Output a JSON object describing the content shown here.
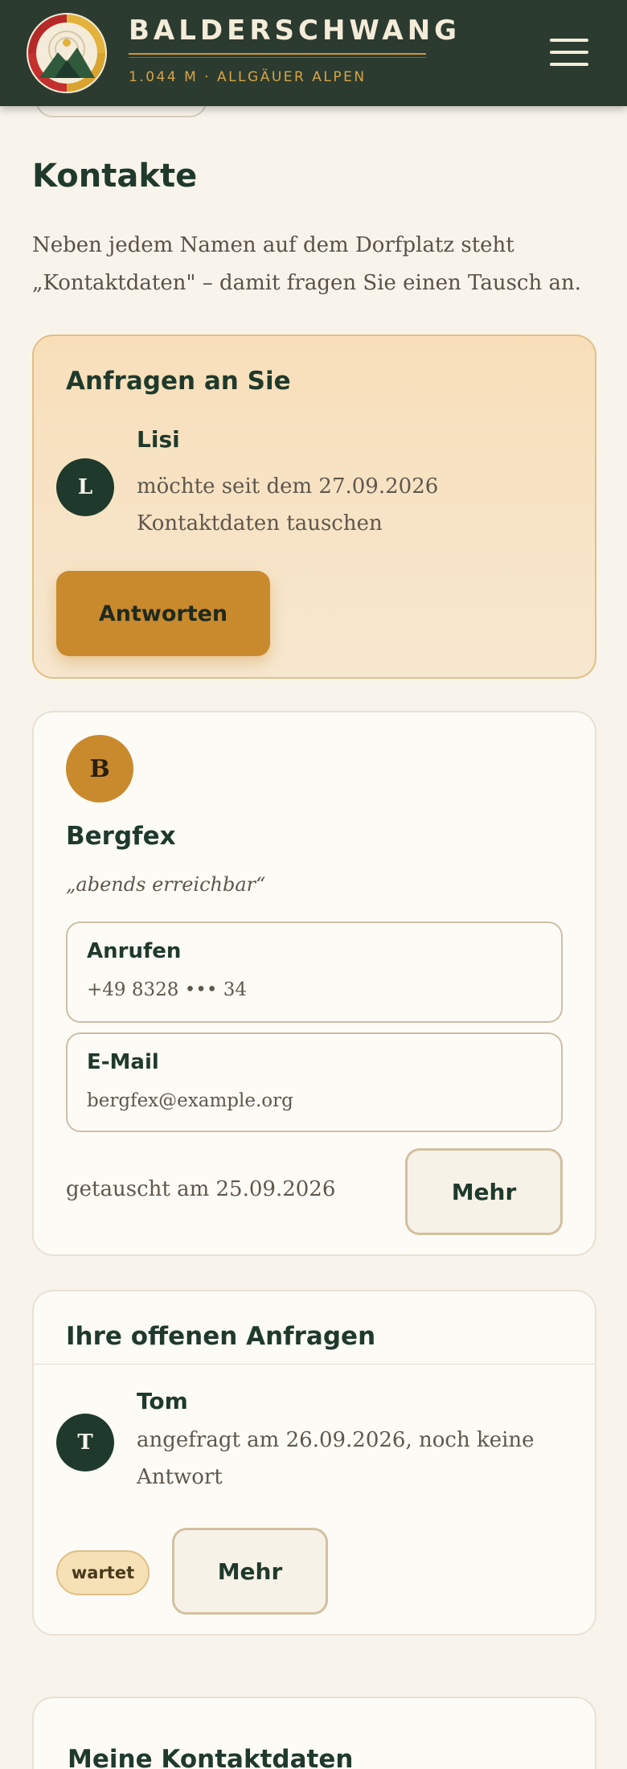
{
  "header": {
    "title": "BALDERSCHWANG",
    "subtitle": "1.044 M · ALLGÄUER ALPEN",
    "menu_icon": "hamburger-menu-icon"
  },
  "page": {
    "title": "Kontakte",
    "intro": "Neben jedem Namen auf dem Dorfplatz steht „Kontaktdaten\" – damit fragen Sie einen Tausch an."
  },
  "incoming": {
    "heading": "Anfragen an Sie",
    "request": {
      "initial": "L",
      "name": "Lisi",
      "text": "möchte seit dem 27.09.2026 Kontaktdaten tauschen"
    },
    "answer_label": "Antworten"
  },
  "contact": {
    "initial": "B",
    "name": "Bergfex",
    "note": "„abends erreichbar“",
    "call_label": "Anrufen",
    "call_value": "+49 8328 ••• 34",
    "email_label": "E-Mail",
    "email_value": "bergfex@example.org",
    "exchanged": "getauscht am 25.09.2026",
    "more_label": "Mehr"
  },
  "outgoing": {
    "heading": "Ihre offenen Anfragen",
    "request": {
      "initial": "T",
      "name": "Tom",
      "text": "angefragt am 26.09.2026, noch keine Antwort"
    },
    "status_badge": "wartet",
    "more_label": "Mehr"
  },
  "mine": {
    "heading": "Meine Kontaktdaten"
  },
  "colors": {
    "header_bg": "#2c3b2f",
    "accent_gold": "#c98a2e",
    "primary_green": "#1f3a2c",
    "page_bg": "#f8f4ec"
  }
}
